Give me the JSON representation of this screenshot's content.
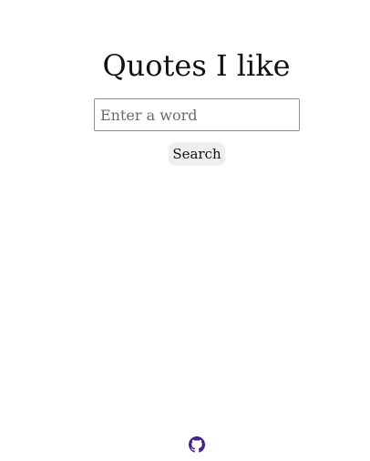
{
  "header": {
    "title": "Quotes I like"
  },
  "search": {
    "placeholder": "Enter a word",
    "value": "",
    "button_label": "Search"
  },
  "footer": {
    "icon": "github-icon",
    "icon_color": "#4b1d8f"
  }
}
